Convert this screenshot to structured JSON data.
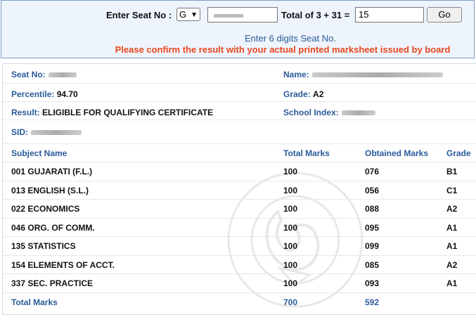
{
  "form": {
    "seat_label": "Enter Seat No :",
    "series_value": "G",
    "captcha_label": "Total of 3 + 31 =",
    "captcha_value": "15",
    "go_label": "Go",
    "hint": "Enter 6 digits Seat No.",
    "warning": "Please confirm the result with your actual printed marksheet issued by board"
  },
  "info": {
    "seat_label": "Seat No:",
    "name_label": "Name:",
    "percentile_label": "Percentile:",
    "percentile_value": "94.70",
    "grade_label": "Grade:",
    "grade_value": "A2",
    "result_label": "Result:",
    "result_value": "ELIGIBLE FOR QUALIFYING CERTIFICATE",
    "school_label": "School Index:",
    "sid_label": "SID:"
  },
  "table": {
    "headers": [
      "Subject Name",
      "Total Marks",
      "Obtained Marks",
      "Grade"
    ],
    "rows": [
      {
        "subject": "001 GUJARATI (F.L.)",
        "total": "100",
        "obtained": "076",
        "grade": "B1"
      },
      {
        "subject": "013 ENGLISH (S.L.)",
        "total": "100",
        "obtained": "056",
        "grade": "C1"
      },
      {
        "subject": "022 ECONOMICS",
        "total": "100",
        "obtained": "088",
        "grade": "A2"
      },
      {
        "subject": "046 ORG. OF COMM.",
        "total": "100",
        "obtained": "095",
        "grade": "A1"
      },
      {
        "subject": "135 STATISTICS",
        "total": "100",
        "obtained": "099",
        "grade": "A1"
      },
      {
        "subject": "154 ELEMENTS OF ACCT.",
        "total": "100",
        "obtained": "085",
        "grade": "A2"
      },
      {
        "subject": "337 SEC. PRACTICE",
        "total": "100",
        "obtained": "093",
        "grade": "A1"
      }
    ],
    "footer": {
      "label": "Total Marks",
      "total": "700",
      "obtained": "592"
    }
  }
}
